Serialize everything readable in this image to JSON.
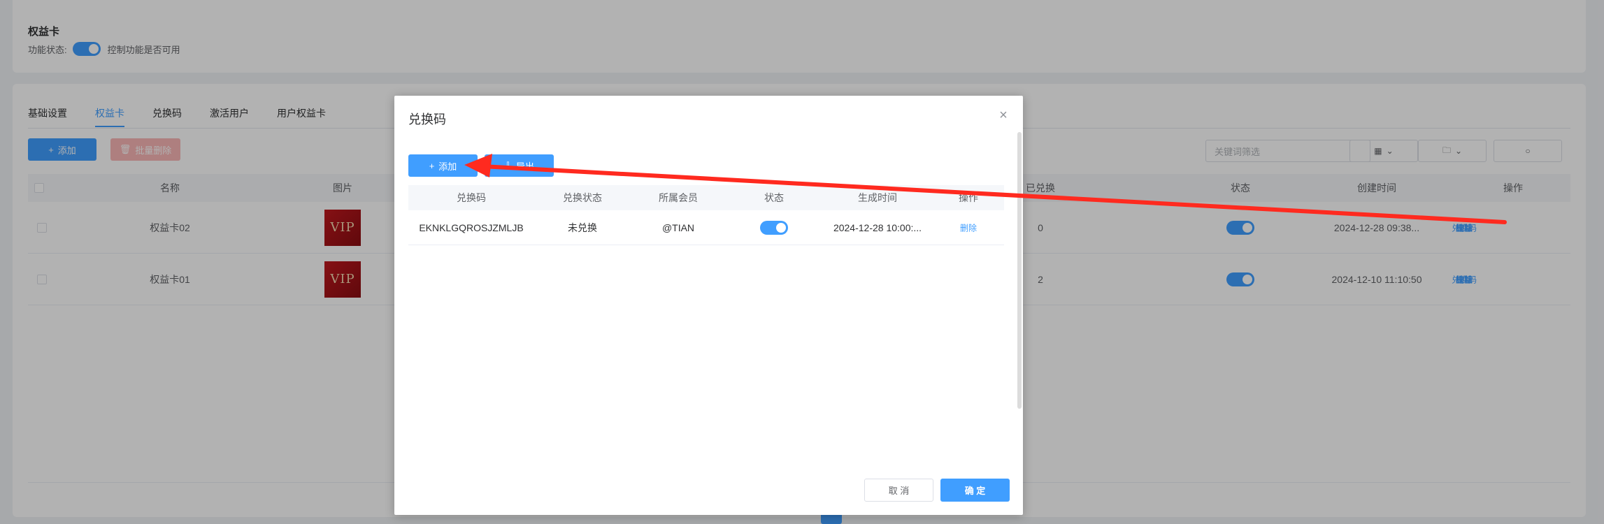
{
  "header": {
    "section_title": "权益卡",
    "feature_label": "功能状态:",
    "feature_desc": "控制功能是否可用"
  },
  "tabs": [
    {
      "label": "基础设置"
    },
    {
      "label": "权益卡"
    },
    {
      "label": "兑换码"
    },
    {
      "label": "激活用户"
    },
    {
      "label": "用户权益卡"
    }
  ],
  "toolbar": {
    "add_label": "添加",
    "batch_delete_label": "批量删除",
    "filter_placeholder": "关键词筛选"
  },
  "bg_table": {
    "columns": [
      "名称",
      "图片",
      "已兑换",
      "状态",
      "创建时间",
      "操作"
    ],
    "rows": [
      {
        "name": "权益卡02",
        "vip": "VIP",
        "redeemed": "0",
        "created": "2024-12-28 09:38...",
        "ops": [
          "编辑",
          "权益",
          "兑换码",
          "删除"
        ]
      },
      {
        "name": "权益卡01",
        "vip": "VIP",
        "redeemed": "2",
        "created": "2024-12-10 11:10:50",
        "ops": [
          "编辑",
          "权益",
          "兑换码",
          "删除"
        ]
      }
    ]
  },
  "dialog": {
    "title": "兑换码",
    "close_icon": "close-icon",
    "add_label": "添加",
    "export_label": "导出",
    "columns": [
      "兑换码",
      "兑换状态",
      "所属会员",
      "状态",
      "生成时间",
      "操作"
    ],
    "rows": [
      {
        "code": "EKNKLGQROSJZMLJB",
        "redeem_status": "未兑换",
        "member": "@TIAN",
        "generated": "2024-12-28 10:00:...",
        "op": "删除"
      }
    ],
    "cancel_label": "取 消",
    "confirm_label": "确 定"
  },
  "colors": {
    "primary": "#409eff",
    "danger_light": "#fab6b6",
    "annotation_arrow": "#ff2a1f"
  }
}
